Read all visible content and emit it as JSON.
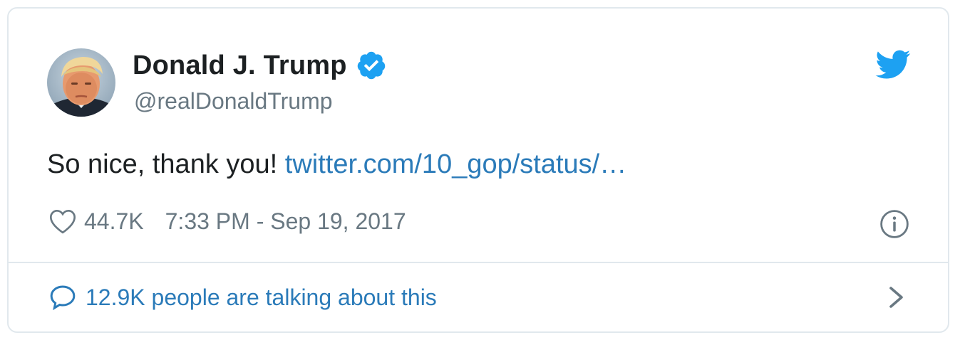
{
  "tweet": {
    "author": {
      "display_name": "Donald J. Trump",
      "handle": "@realDonaldTrump",
      "verified": true,
      "avatar_icon": "profile-photo"
    },
    "text": "So nice, thank you!",
    "link_text": "twitter.com/10_gop/status/…",
    "likes": "44.7K",
    "timestamp": "7:33 PM - Sep 19, 2017",
    "footer_text": "12.9K people are talking about this"
  },
  "icons": {
    "brand": "twitter-bird-icon",
    "verified": "verified-badge-icon",
    "like": "heart-icon",
    "info": "info-icon",
    "reply": "speech-bubble-icon",
    "chevron": "chevron-right-icon"
  },
  "colors": {
    "twitter_blue": "#1da1f2",
    "link_blue": "#2b7bb9",
    "text_primary": "#1c2022",
    "text_secondary": "#697882",
    "border": "#e1e8ed"
  }
}
